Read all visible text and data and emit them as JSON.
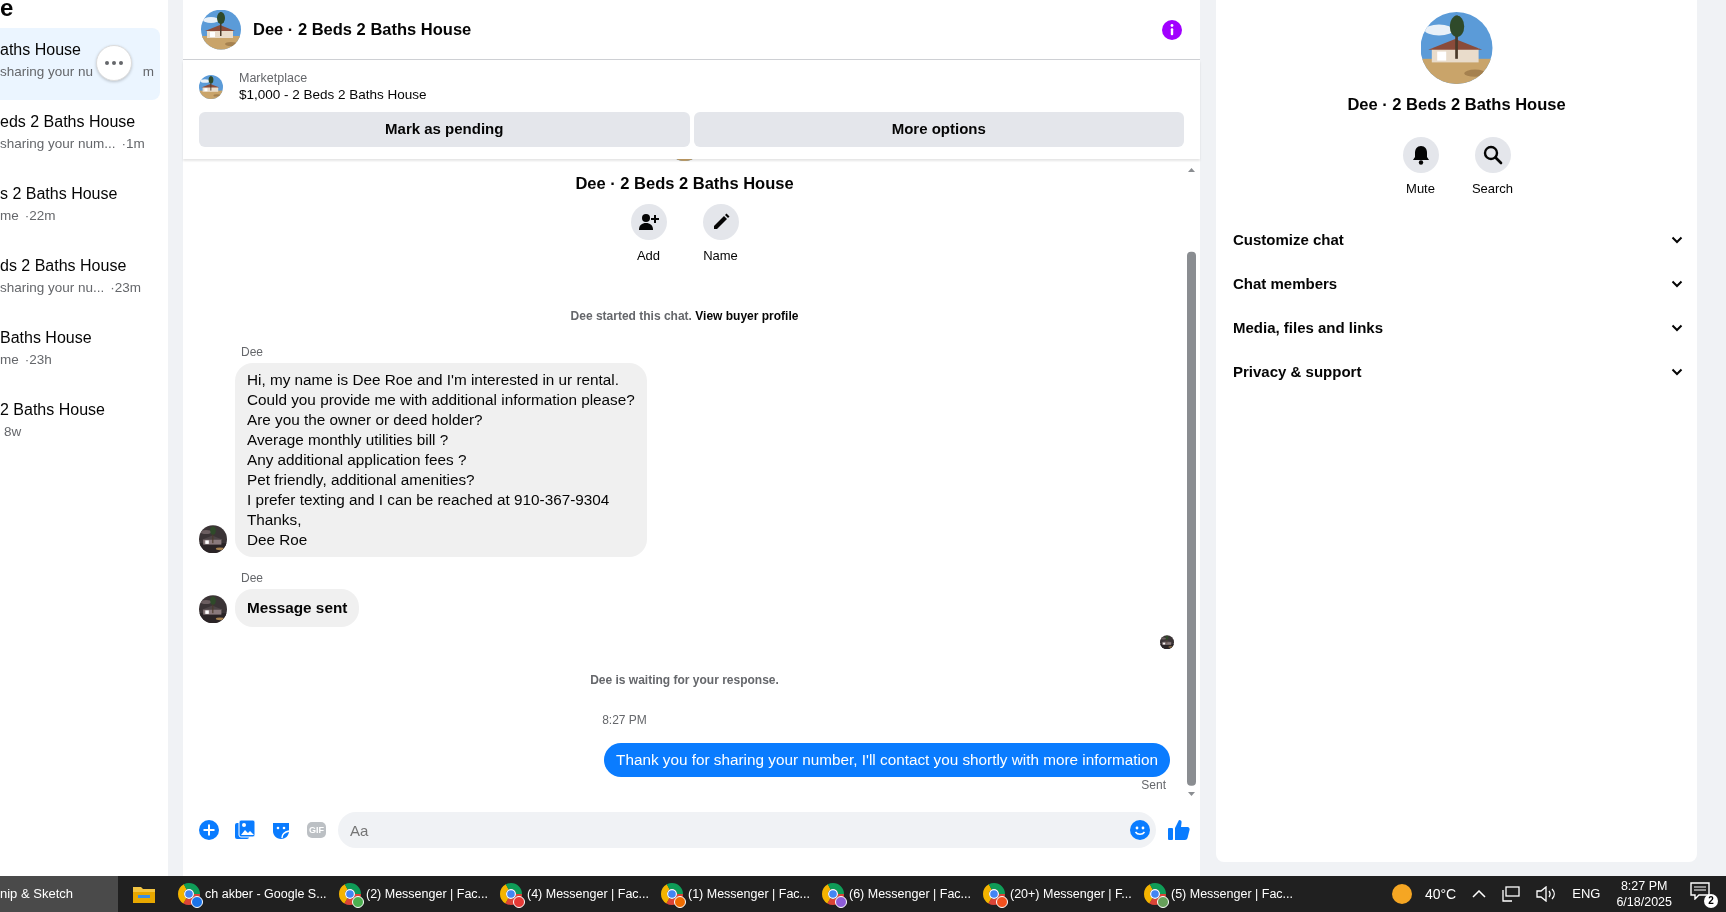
{
  "sidebar": {
    "title": "e",
    "conversations": [
      {
        "title": "aths House",
        "preview": "sharing your nu",
        "time": "m",
        "selected": true
      },
      {
        "title": "eds 2 Baths House",
        "preview": "sharing your num...",
        "time": "·1m",
        "selected": false
      },
      {
        "title": "s 2 Baths House",
        "preview": "me",
        "time": "·22m",
        "selected": false
      },
      {
        "title": "ds 2 Baths House",
        "preview": "sharing your nu...",
        "time": "·23m",
        "selected": false
      },
      {
        "title": "Baths House",
        "preview": "me",
        "time": "·23h",
        "selected": false
      },
      {
        "title": "2 Baths House",
        "time": "8w",
        "selected": false
      }
    ]
  },
  "chat": {
    "title": "Dee · 2 Beds 2 Baths House",
    "listing": {
      "label": "Marketplace",
      "name": "$1,000 - 2 Beds 2 Baths House"
    },
    "actions": [
      "Mark as pending",
      "More options"
    ],
    "intro": {
      "title": "Dee · 2 Beds 2 Baths House",
      "buttons": [
        {
          "kind": "add",
          "label": "Add"
        },
        {
          "kind": "name",
          "label": "Name"
        }
      ],
      "started": "Dee started this chat.",
      "link": "View buyer profile"
    },
    "messages": [
      {
        "kind": "incoming",
        "sender": "Dee",
        "text": "Hi, my name is Dee Roe and I'm interested in ur rental.\nCould you provide me with additional information please?\nAre you the owner or deed holder?\nAverage monthly utilities bill ?\nAny additional application fees ?\nPet friendly, additional amenities?\nI prefer texting and I can be reached at 910-367-9304\nThanks,\nDee Roe",
        "emphasis": false
      },
      {
        "kind": "incoming",
        "sender": "Dee",
        "text": "Message sent",
        "emphasis": true
      },
      {
        "kind": "seen"
      },
      {
        "kind": "notice",
        "text": "Dee is waiting for your response."
      },
      {
        "kind": "time",
        "text": "8:27 PM"
      },
      {
        "kind": "outgoing",
        "text": "Thank you for sharing your number, I'll contact you shortly with more information",
        "status": "Sent"
      }
    ],
    "composer": {
      "placeholder": "Aa",
      "gif": "GIF"
    }
  },
  "details": {
    "title": "Dee · 2 Beds 2 Baths House",
    "actions": [
      {
        "kind": "mute",
        "label": "Mute"
      },
      {
        "kind": "search",
        "label": "Search"
      }
    ],
    "sections": [
      {
        "label": "Customize chat",
        "expanded": false
      },
      {
        "label": "Chat members",
        "expanded": false
      },
      {
        "label": "Media, files and links",
        "expanded": false
      },
      {
        "label": "Privacy & support",
        "expanded": false
      }
    ]
  },
  "taskbar": {
    "items": [
      {
        "kind": "app",
        "label": "nip & Sketch"
      },
      {
        "kind": "explorer"
      },
      {
        "kind": "chrome",
        "label": "ch akber - Google S...",
        "color": "#1a73e8"
      },
      {
        "kind": "chrome",
        "label": "(2) Messenger | Fac...",
        "color": "#4caf50"
      },
      {
        "kind": "chrome",
        "label": "(4) Messenger | Fac...",
        "color": "#e53935"
      },
      {
        "kind": "chrome",
        "label": "(1) Messenger | Fac...",
        "color": "#ef6c00"
      },
      {
        "kind": "chrome",
        "label": "(6) Messenger | Fac...",
        "color": "#8e5cd9"
      },
      {
        "kind": "chrome",
        "label": "(20+) Messenger | F...",
        "color": "#f4511e"
      },
      {
        "kind": "chrome",
        "label": "(5) Messenger | Fac...",
        "color": "#66a05a"
      }
    ],
    "tray": {
      "temperature": "40°C",
      "language": "ENG",
      "time": "8:27 PM",
      "date": "6/18/2025",
      "notifications": "2"
    }
  }
}
